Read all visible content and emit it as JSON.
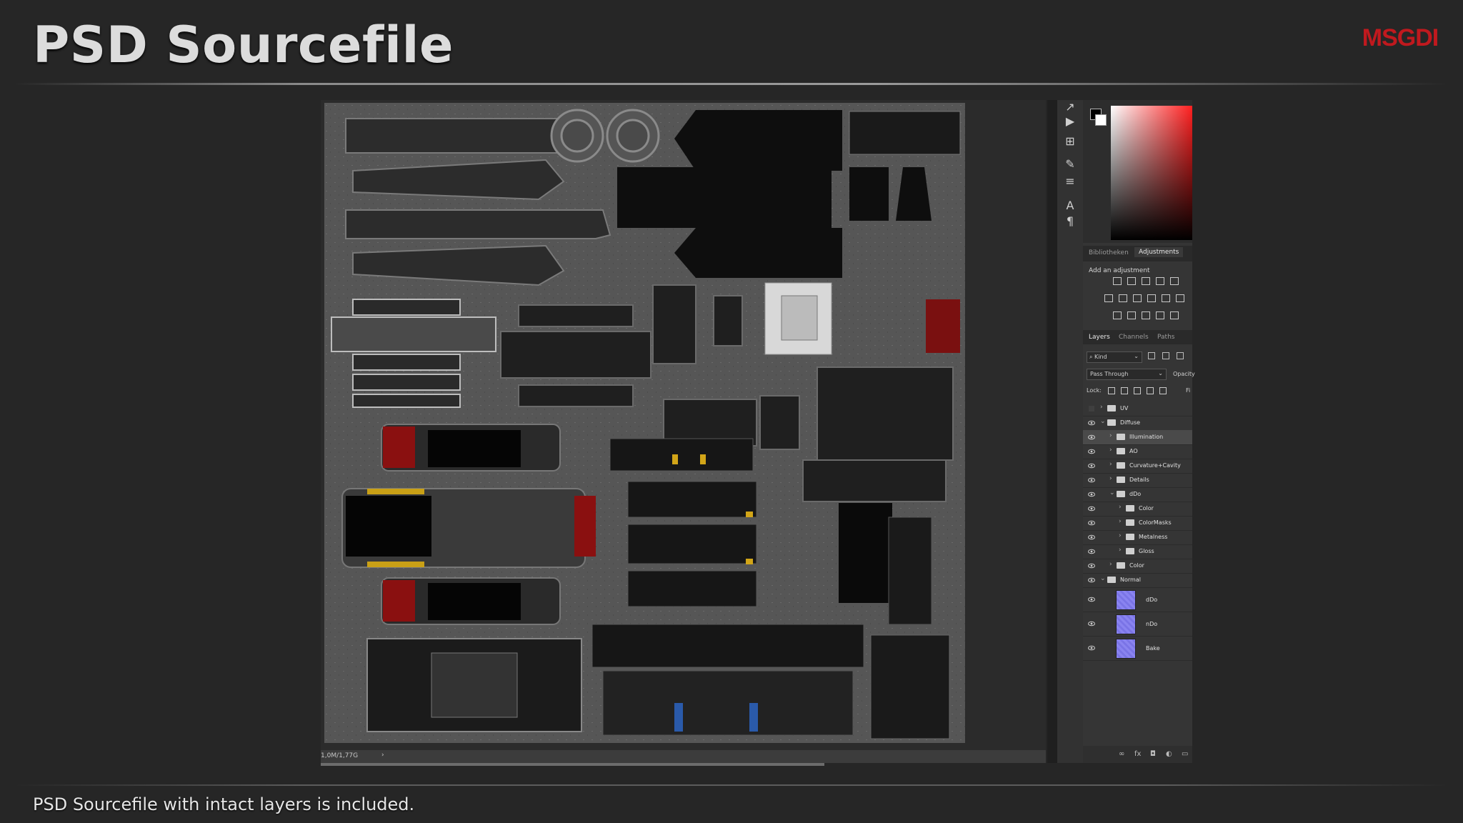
{
  "header": {
    "title": "PSD Sourcefile",
    "logo": "MSGDI"
  },
  "caption": "PSD Sourcefile with intact layers is included.",
  "status": {
    "zoom": "1,0M/1,77G",
    "arrow": "›"
  },
  "toolbar": {
    "icons": [
      "path-select-icon",
      "play-icon",
      "3d-icon",
      "brush-icon",
      "sliders-icon",
      "character-icon",
      "paragraph-icon"
    ]
  },
  "panels": {
    "tabs": [
      "Bibliotheken",
      "Adjustments"
    ],
    "active_tab": "Adjustments",
    "adjustments_title": "Add an adjustment",
    "layer_tabs": [
      "Layers",
      "Channels",
      "Paths"
    ],
    "kind": "Kind",
    "blend_mode": "Pass Through",
    "opacity_label": "Opacity",
    "lock_label": "Lock:",
    "fill_label": "Fi"
  },
  "layers": [
    {
      "name": "UV",
      "visible": false,
      "depth": 0,
      "type": "folder",
      "expanded": false
    },
    {
      "name": "Diffuse",
      "visible": true,
      "depth": 0,
      "type": "folder",
      "expanded": true
    },
    {
      "name": "Illumination",
      "visible": true,
      "depth": 1,
      "type": "folder",
      "expanded": false,
      "selected": true
    },
    {
      "name": "AO",
      "visible": true,
      "depth": 1,
      "type": "folder",
      "expanded": false
    },
    {
      "name": "Curvature+Cavity",
      "visible": true,
      "depth": 1,
      "type": "folder",
      "expanded": false
    },
    {
      "name": "Details",
      "visible": true,
      "depth": 1,
      "type": "folder",
      "expanded": false
    },
    {
      "name": "dDo",
      "visible": true,
      "depth": 1,
      "type": "folder",
      "expanded": true
    },
    {
      "name": "Color",
      "visible": true,
      "depth": 2,
      "type": "folder",
      "expanded": false
    },
    {
      "name": "ColorMasks",
      "visible": true,
      "depth": 2,
      "type": "folder",
      "expanded": false
    },
    {
      "name": "Metalness",
      "visible": true,
      "depth": 2,
      "type": "folder",
      "expanded": false
    },
    {
      "name": "Gloss",
      "visible": true,
      "depth": 2,
      "type": "folder",
      "expanded": false
    },
    {
      "name": "Color",
      "visible": true,
      "depth": 1,
      "type": "folder",
      "expanded": false
    },
    {
      "name": "Normal",
      "visible": true,
      "depth": 0,
      "type": "folder",
      "expanded": true
    },
    {
      "name": "dDo",
      "visible": true,
      "depth": 1,
      "type": "image"
    },
    {
      "name": "nDo",
      "visible": true,
      "depth": 1,
      "type": "image"
    },
    {
      "name": "Bake",
      "visible": true,
      "depth": 1,
      "type": "image"
    }
  ],
  "colors": {
    "accent_red": "#c0191e",
    "panel_bg": "#353535",
    "texture_gray": "#5a5a5a",
    "normal_thumb": "#8a84f0"
  }
}
